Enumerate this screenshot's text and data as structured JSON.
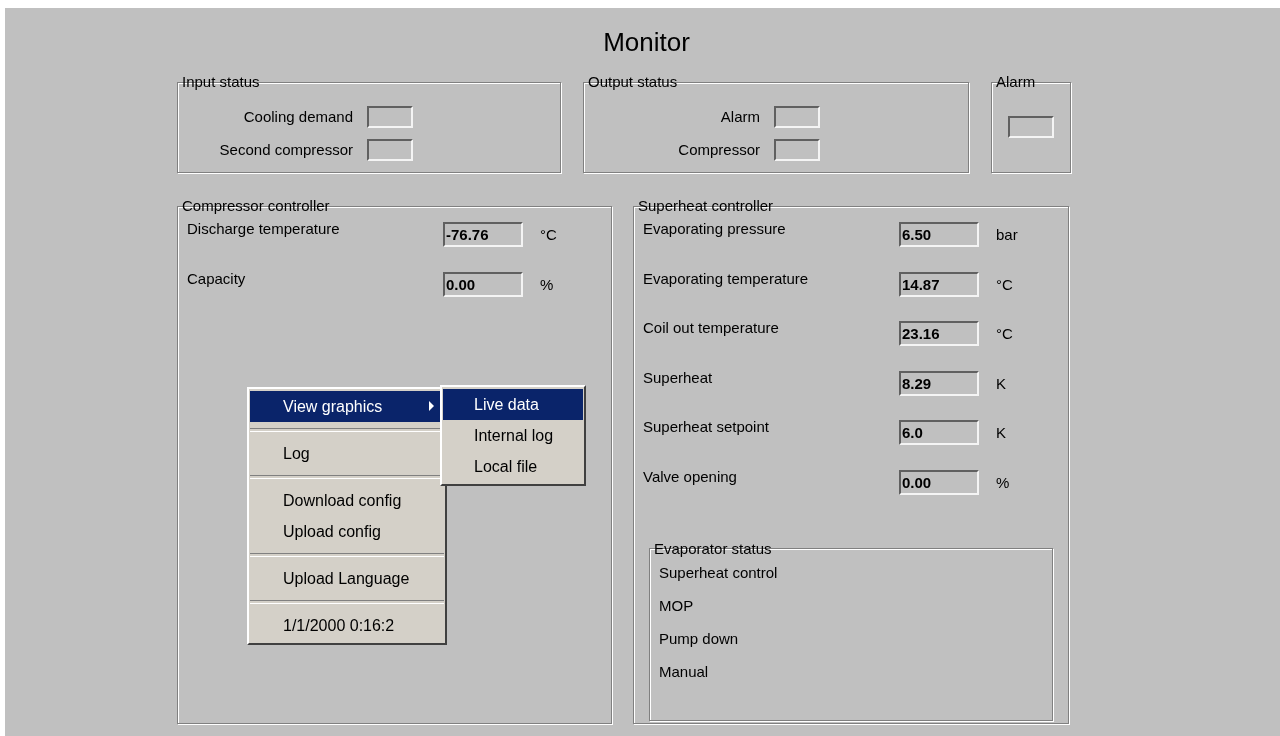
{
  "title": "Monitor",
  "input_status": {
    "title": "Input status",
    "items": [
      {
        "label": "Cooling demand"
      },
      {
        "label": "Second compressor"
      }
    ]
  },
  "output_status": {
    "title": "Output status",
    "items": [
      {
        "label": "Alarm"
      },
      {
        "label": "Compressor"
      }
    ]
  },
  "alarm": {
    "title": "Alarm"
  },
  "compressor_controller": {
    "title": "Compressor controller",
    "rows": [
      {
        "label": "Discharge temperature",
        "value": "-76.76",
        "unit": "°C"
      },
      {
        "label": "Capacity",
        "value": "0.00",
        "unit": "%"
      }
    ]
  },
  "superheat_controller": {
    "title": "Superheat controller",
    "rows": [
      {
        "label": "Evaporating pressure",
        "value": "6.50",
        "unit": "bar"
      },
      {
        "label": "Evaporating temperature",
        "value": "14.87",
        "unit": "°C"
      },
      {
        "label": "Coil out temperature",
        "value": "23.16",
        "unit": "°C"
      },
      {
        "label": "Superheat",
        "value": "8.29",
        "unit": "K"
      },
      {
        "label": "Superheat setpoint",
        "value": "6.0",
        "unit": "K"
      },
      {
        "label": "Valve opening",
        "value": "0.00",
        "unit": "%"
      }
    ],
    "evaporator_status": {
      "title": "Evaporator status",
      "items": [
        "Superheat control",
        "MOP",
        "Pump down",
        "Manual"
      ]
    }
  },
  "context_menu": {
    "sections": [
      [
        {
          "label": "View graphics",
          "selected": true,
          "has_submenu": true
        }
      ],
      [
        {
          "label": "Log",
          "selected": false,
          "has_submenu": false
        }
      ],
      [
        {
          "label": "Download config",
          "selected": false,
          "has_submenu": false
        },
        {
          "label": "Upload config",
          "selected": false,
          "has_submenu": false
        }
      ],
      [
        {
          "label": "Upload Language",
          "selected": false,
          "has_submenu": false
        }
      ],
      [
        {
          "label": "1/1/2000 0:16:2",
          "selected": false,
          "has_submenu": false
        }
      ]
    ],
    "submenu": {
      "items": [
        {
          "label": "Live data",
          "selected": true
        },
        {
          "label": "Internal log",
          "selected": false
        },
        {
          "label": "Local file",
          "selected": false
        }
      ]
    }
  }
}
